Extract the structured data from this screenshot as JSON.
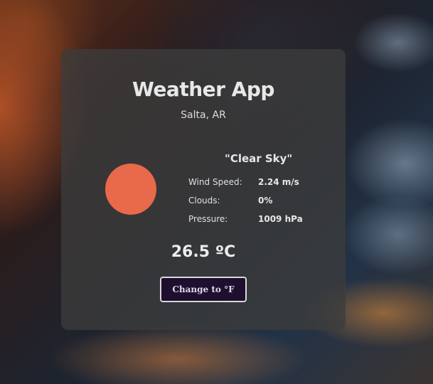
{
  "app": {
    "title": "Weather App",
    "location": "Salta, AR"
  },
  "weather": {
    "description": "\"Clear Sky\"",
    "icon": "sun-icon",
    "icon_color": "#e86a4a",
    "details": [
      {
        "label": "Wind Speed:",
        "value": "2.24 m/s"
      },
      {
        "label": "Clouds:",
        "value": "0%"
      },
      {
        "label": "Pressure:",
        "value": "1009 hPa"
      }
    ],
    "temperature": "26.5 ºC"
  },
  "controls": {
    "unit_button_label": "Change to °F"
  },
  "colors": {
    "card_background": "rgba(60,60,60,0.78)",
    "button_background": "#1e0f2e"
  }
}
